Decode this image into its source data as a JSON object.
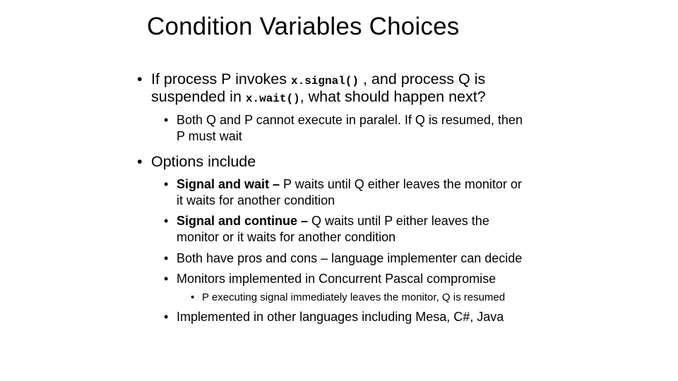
{
  "slide": {
    "title": "Condition Variables Choices",
    "bullets": {
      "b1": {
        "pre": "If process P invokes ",
        "code1": "x.signal()",
        "mid1": " , and process Q is",
        "line2_pre": "suspended in ",
        "code2": "x.wait()",
        "line2_post": ", what should happen next?"
      },
      "b1_sub1": {
        "line1": "Both Q and P cannot execute in paralel. If Q is resumed, then",
        "line2": "P must wait"
      },
      "b2": {
        "text": "Options include"
      },
      "b2_sub1": {
        "bold": "Signal and wait –",
        "rest": " P waits until Q either leaves the monitor or",
        "line2": "it waits for another condition"
      },
      "b2_sub2": {
        "bold": "Signal and continue –",
        "rest": " Q waits until P either leaves the",
        "line2": "monitor or it  waits for another condition"
      },
      "b2_sub3": {
        "text": "Both have pros and cons – language implementer can decide"
      },
      "b2_sub4": {
        "text": "Monitors implemented in Concurrent Pascal compromise"
      },
      "b2_sub4_sub1": {
        "text": "P executing signal immediately leaves the monitor, Q is resumed"
      },
      "b2_sub5": {
        "text": "Implemented in other languages including Mesa, C#, Java"
      }
    },
    "bullet_glyph": "•"
  }
}
